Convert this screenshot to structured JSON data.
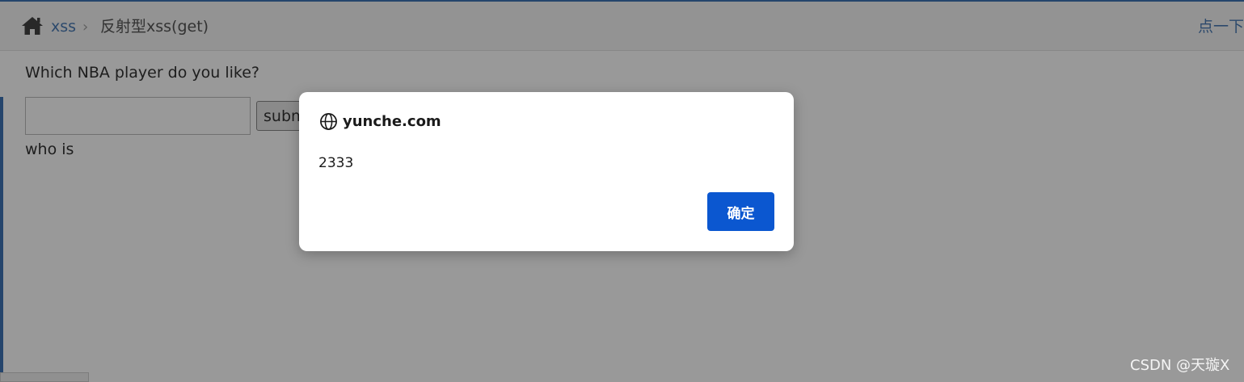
{
  "breadcrumb": {
    "home_icon": "home-icon",
    "link": "xss",
    "separator": "›",
    "current": "反射型xss(get)"
  },
  "header": {
    "right_link": "点一下"
  },
  "form": {
    "question": "Which NBA player do you like?",
    "input_value": "",
    "submit_label": "submit",
    "answer": "who is"
  },
  "dialog": {
    "origin_icon": "globe-icon",
    "origin": "yunche.com",
    "message": "2333",
    "ok_label": "确定"
  },
  "watermark": "CSDN @天璇X",
  "colors": {
    "accent": "#3f74b5",
    "link": "#4a7bb4",
    "dialog_button": "#0b57d0"
  }
}
